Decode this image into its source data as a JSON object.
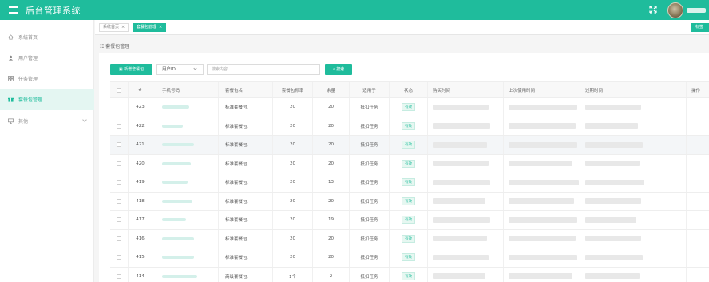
{
  "app": {
    "title": "后台管理系统",
    "brand_color": "#1fbc9c"
  },
  "sidebar": {
    "items": [
      {
        "label": "系统首页",
        "icon": "home-icon"
      },
      {
        "label": "用户管理",
        "icon": "user-icon"
      },
      {
        "label": "任务管理",
        "icon": "grid-icon"
      },
      {
        "label": "套餐包管理",
        "icon": "gift-icon",
        "active": true
      },
      {
        "label": "其他",
        "icon": "monitor-icon",
        "expandable": true
      }
    ]
  },
  "tabs": [
    {
      "label": "系统首页",
      "close": "×"
    },
    {
      "label": "套餐包管理",
      "close": "×",
      "active": true
    }
  ],
  "tab_right_label": "标签",
  "breadcrumb": "套餐包管理",
  "toolbar": {
    "add_label": "新增套餐包",
    "select_value": "用户ID",
    "search_placeholder": "搜索内容",
    "search_label": "搜索"
  },
  "table": {
    "headers": [
      "#",
      "手机号码",
      "套餐包名",
      "套餐包频率",
      "余量",
      "适用于",
      "状态",
      "购买时间",
      "上次使用时间",
      "过期时间",
      "操作"
    ],
    "rows": [
      {
        "id": "423",
        "name": "标准套餐包",
        "count": "20",
        "remain": "20",
        "use": "抵扣任务",
        "status": "有效"
      },
      {
        "id": "422",
        "name": "标准套餐包",
        "count": "20",
        "remain": "20",
        "use": "抵扣任务",
        "status": "有效"
      },
      {
        "id": "421",
        "name": "标准套餐包",
        "count": "20",
        "remain": "20",
        "use": "抵扣任务",
        "status": "有效"
      },
      {
        "id": "420",
        "name": "标准套餐包",
        "count": "20",
        "remain": "20",
        "use": "抵扣任务",
        "status": "有效"
      },
      {
        "id": "419",
        "name": "标准套餐包",
        "count": "20",
        "remain": "13",
        "use": "抵扣任务",
        "status": "有效"
      },
      {
        "id": "418",
        "name": "标准套餐包",
        "count": "20",
        "remain": "20",
        "use": "抵扣任务",
        "status": "有效"
      },
      {
        "id": "417",
        "name": "标准套餐包",
        "count": "20",
        "remain": "19",
        "use": "抵扣任务",
        "status": "有效"
      },
      {
        "id": "416",
        "name": "标准套餐包",
        "count": "20",
        "remain": "20",
        "use": "抵扣任务",
        "status": "有效"
      },
      {
        "id": "415",
        "name": "标准套餐包",
        "count": "20",
        "remain": "20",
        "use": "抵扣任务",
        "status": "有效"
      },
      {
        "id": "414",
        "name": "高级套餐包",
        "count": "1个",
        "remain": "2",
        "use": "抵扣任务",
        "status": "有效"
      }
    ]
  }
}
